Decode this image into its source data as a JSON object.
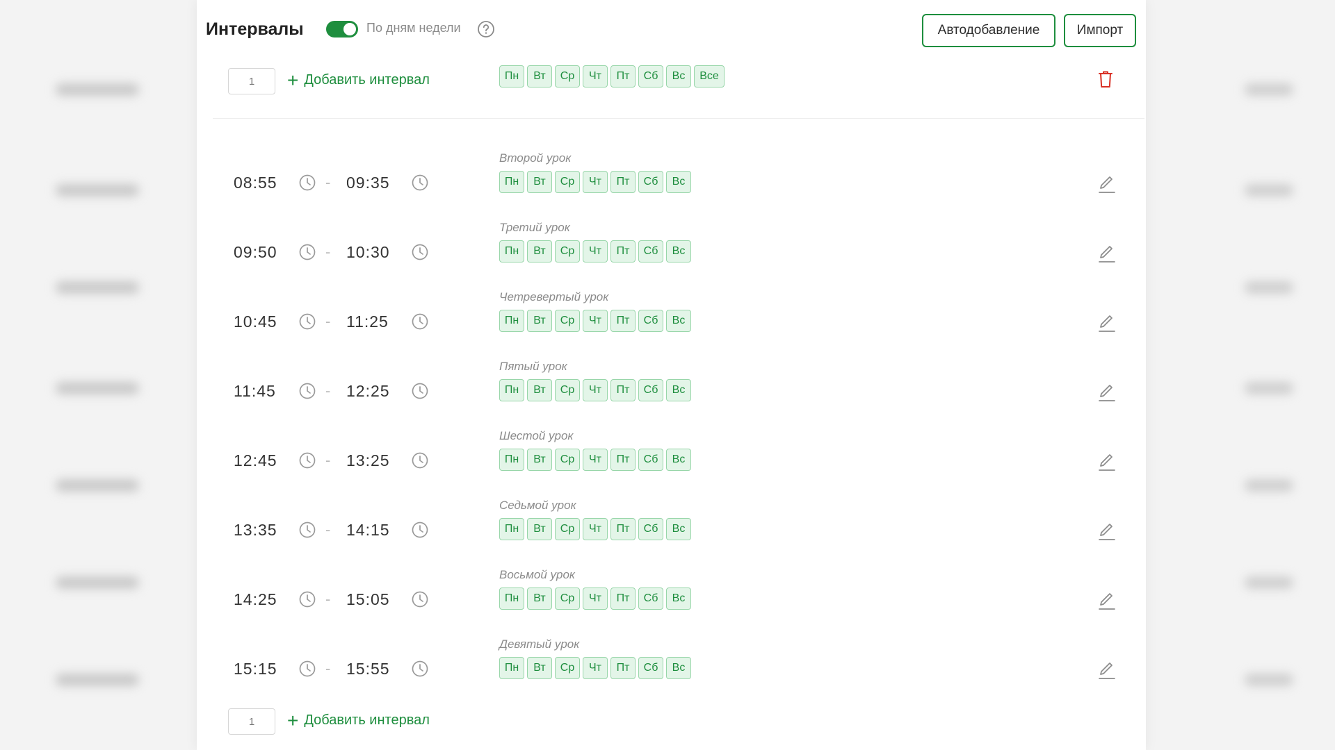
{
  "header": {
    "title": "Интервалы",
    "toggle_label": "По дням недели",
    "toggle_on": true,
    "auto_add_button": "Автодобавление",
    "import_button": "Импорт"
  },
  "colors": {
    "accent": "#1e8e3e",
    "chip_bg": "#e3f5e8",
    "chip_border": "#98d6a9",
    "danger": "#d93025"
  },
  "add_top": {
    "count_placeholder": "1",
    "label": "Добавить интервал"
  },
  "add_bottom": {
    "count_placeholder": "1",
    "label": "Добавить интервал"
  },
  "weekdays_all": [
    "Пн",
    "Вт",
    "Ср",
    "Чт",
    "Пт",
    "Сб",
    "Вс",
    "Все"
  ],
  "weekdays": [
    "Пн",
    "Вт",
    "Ср",
    "Чт",
    "Пт",
    "Сб",
    "Вс"
  ],
  "intervals": [
    {
      "start": "08:55",
      "end": "09:35",
      "name": "Второй урок"
    },
    {
      "start": "09:50",
      "end": "10:30",
      "name": "Третий урок"
    },
    {
      "start": "10:45",
      "end": "11:25",
      "name": "Четревертый урок"
    },
    {
      "start": "11:45",
      "end": "12:25",
      "name": "Пятый урок"
    },
    {
      "start": "12:45",
      "end": "13:25",
      "name": "Шестой урок"
    },
    {
      "start": "13:35",
      "end": "14:15",
      "name": "Седьмой урок"
    },
    {
      "start": "14:25",
      "end": "15:05",
      "name": "Восьмой урок"
    },
    {
      "start": "15:15",
      "end": "15:55",
      "name": "Девятый урок"
    }
  ],
  "separator": "-",
  "icons": {
    "toggle": "toggle-switch",
    "help": "question-circle-icon",
    "plus": "plus-icon",
    "trash": "trash-icon",
    "clock": "clock-icon",
    "edit": "pencil-icon"
  }
}
